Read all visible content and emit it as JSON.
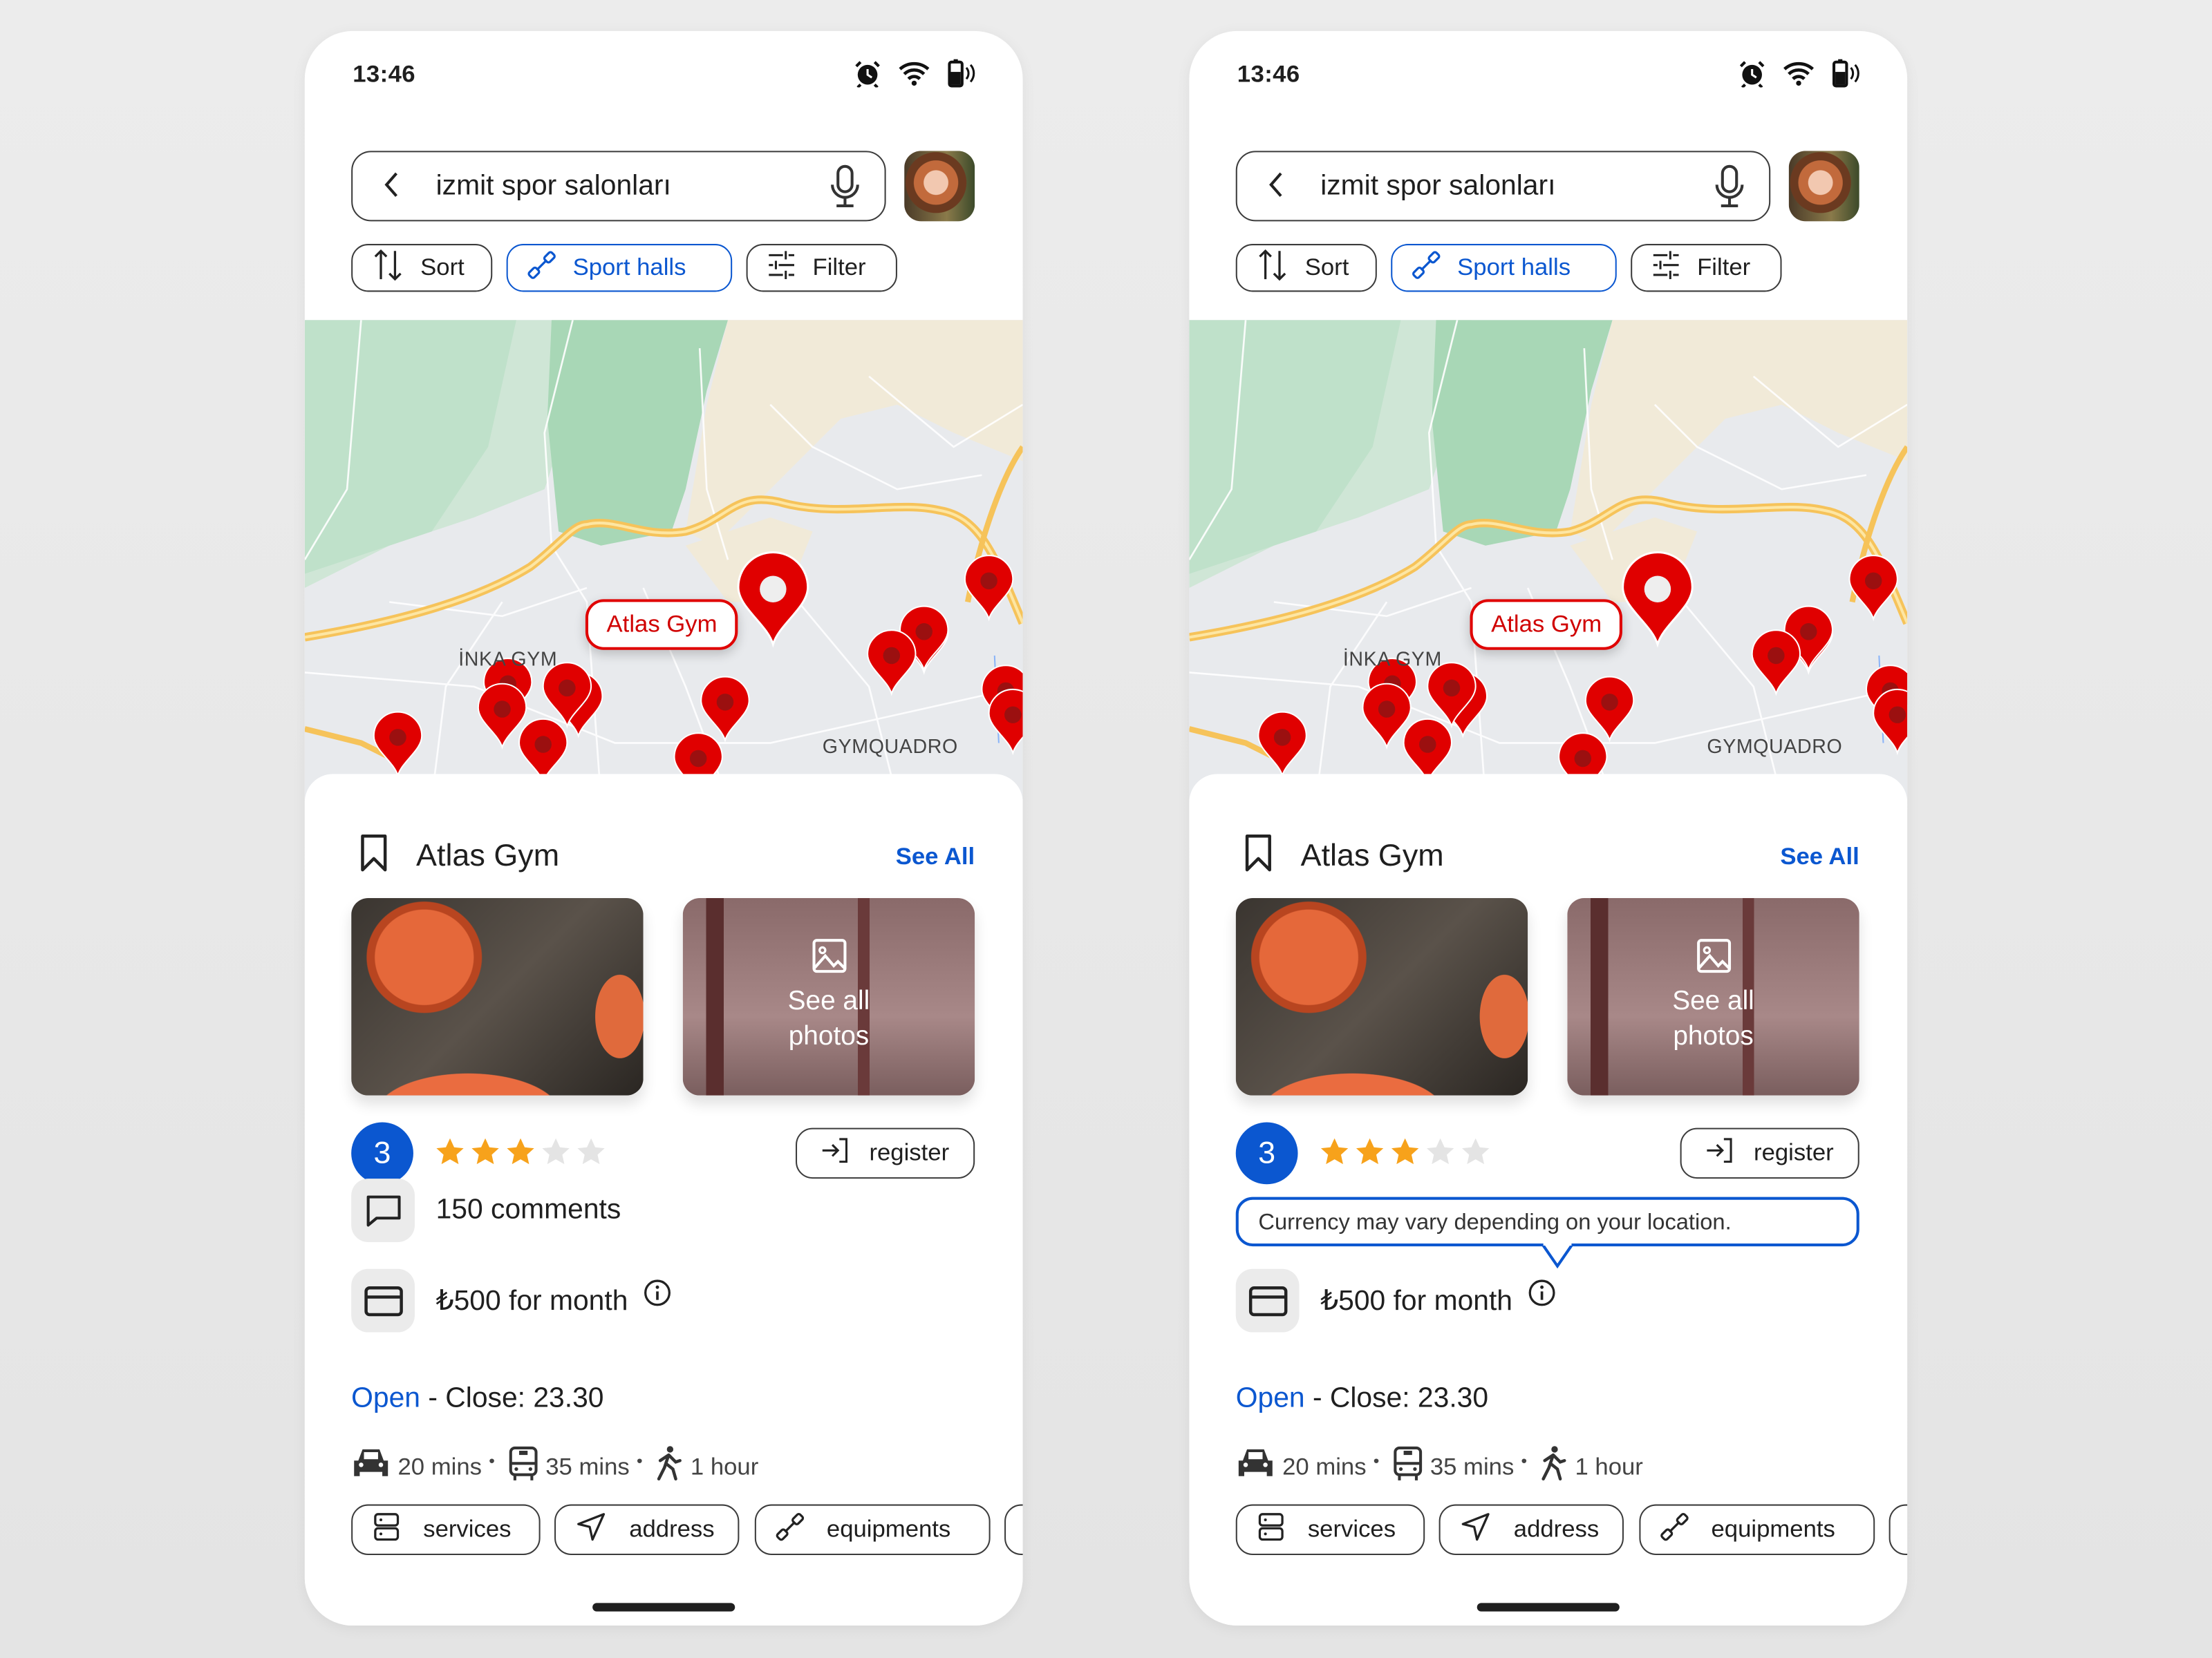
{
  "app": {
    "status": {
      "time": "13:46",
      "icons": [
        "alarm-icon",
        "wifi-icon",
        "battery-vibrate-icon"
      ]
    },
    "search": {
      "query": "izmit spor salonları",
      "icons": [
        "back-arrow-icon",
        "microphone-icon"
      ]
    },
    "chips": [
      {
        "label": "Sort",
        "icon": "sort-arrows-icon",
        "active": false
      },
      {
        "label": "Sport halls",
        "icon": "dumbbell-icon",
        "active": true
      },
      {
        "label": "Filter",
        "icon": "sliders-icon",
        "active": false
      }
    ],
    "map": {
      "selected_label": "Atlas Gym",
      "labels": [
        "İNKA GYM",
        "GYMQUADRO"
      ],
      "pin_color": "#e00000"
    },
    "place": {
      "name": "Atlas Gym",
      "see_all": "See All",
      "photos_overlay": "See all photos",
      "rating": "3",
      "rating_value": 3,
      "rating_max": 5,
      "register": "register",
      "comments": "150 comments",
      "price": "₺500 for month",
      "open": "Open",
      "close": " - Close: 23.30",
      "travel": [
        {
          "icon": "car-icon",
          "label": "20 mins"
        },
        {
          "icon": "bus-icon",
          "label": "35 mins"
        },
        {
          "icon": "walking-icon",
          "label": "1 hour"
        }
      ],
      "tags": [
        {
          "label": "services",
          "icon": "server-icon"
        },
        {
          "label": "address",
          "icon": "navigation-arrow-icon"
        },
        {
          "label": "equipments",
          "icon": "dumbbell-icon"
        }
      ]
    },
    "colors": {
      "accent": "#0b57d0",
      "star": "#f7a21b",
      "star_empty": "#e4e4e4",
      "pin": "#e00000"
    }
  },
  "screens": [
    {
      "variant": "default"
    },
    {
      "variant": "currency-tooltip",
      "tooltip": "Currency may vary depending on your location."
    }
  ]
}
